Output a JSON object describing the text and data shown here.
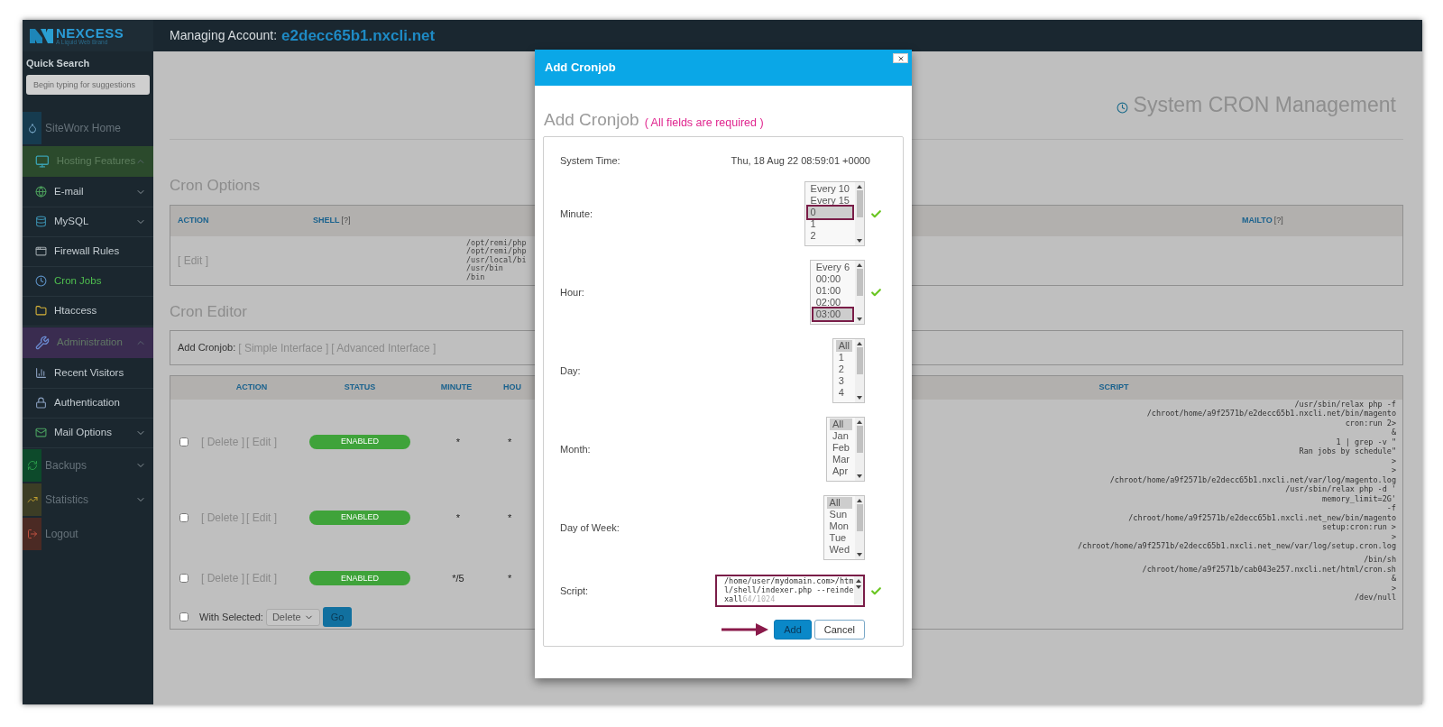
{
  "header": {
    "logo_name": "NEXCESS",
    "logo_tagline": "A Liquid Web Brand",
    "account_label": "Managing Account:",
    "account_name": "e2decc65b1.nxcli.net"
  },
  "sidebar": {
    "search_label": "Quick Search",
    "search_placeholder": "Begin typing for suggestions",
    "items": [
      {
        "label": "SiteWorx Home",
        "kind": "tile",
        "color": "#163b4f",
        "selected": false
      },
      {
        "label": "Hosting Features",
        "kind": "band",
        "color": "#2b4a2c",
        "selected": false,
        "expanded": true
      },
      {
        "label": "E-mail",
        "kind": "item",
        "selected": false,
        "expanded": false
      },
      {
        "label": "MySQL",
        "kind": "item",
        "selected": false,
        "expanded": false
      },
      {
        "label": "Firewall Rules",
        "kind": "item",
        "selected": false
      },
      {
        "label": "Cron Jobs",
        "kind": "item",
        "selected": true
      },
      {
        "label": "Htaccess",
        "kind": "item",
        "selected": false
      },
      {
        "label": "Administration",
        "kind": "band",
        "color": "#3a2c50",
        "selected": false,
        "expanded": true
      },
      {
        "label": "Recent Visitors",
        "kind": "item",
        "selected": false
      },
      {
        "label": "Authentication",
        "kind": "item",
        "selected": false
      },
      {
        "label": "Mail Options",
        "kind": "item",
        "selected": false,
        "expanded": false
      },
      {
        "label": "Backups",
        "kind": "tile",
        "color": "#0d4a2b",
        "selected": false,
        "expanded": false
      },
      {
        "label": "Statistics",
        "kind": "tile",
        "color": "#3c3d25",
        "selected": false,
        "expanded": false
      },
      {
        "label": "Logout",
        "kind": "tile",
        "color": "#4b2a24",
        "selected": false
      }
    ]
  },
  "page": {
    "title": "System CRON Management",
    "cron_options": {
      "heading": "Cron Options",
      "columns": [
        {
          "label": "ACTION"
        },
        {
          "label": "SHELL",
          "help": "[?]"
        },
        {
          "label": "MAILTO",
          "help": "[?]"
        }
      ],
      "row": {
        "action": "[ Edit ]",
        "shell": [
          "/opt/remi/php",
          "/opt/remi/php",
          "/usr/local/bi",
          "/usr/bin",
          "/bin"
        ]
      }
    },
    "cron_editor": {
      "heading": "Cron Editor",
      "add_label": "Add Cronjob:",
      "links": [
        "[ Simple Interface ]",
        "[ Advanced Interface ]"
      ],
      "columns": [
        "ACTION",
        "STATUS",
        "MINUTE",
        "HOU",
        "SCRIPT"
      ],
      "rows": [
        {
          "checked": false,
          "actions": [
            "[ Delete ]",
            "[ Edit ]"
          ],
          "status": "ENABLED",
          "enabled": true,
          "minute": "*",
          "hour": "*",
          "script": "/usr/sbin/relax php -f\n/chroot/home/a9f2571b/e2decc65b1.nxcli.net/bin/magento\ncron:run 2>\n&\n1 | grep -v \"\nRan jobs by schedule\"\n>\n>\n/chroot/home/a9f2571b/e2decc65b1.nxcli.net/var/log/magento.log"
        },
        {
          "checked": false,
          "actions": [
            "[ Delete ]",
            "[ Edit ]"
          ],
          "status": "ENABLED",
          "enabled": true,
          "minute": "*",
          "hour": "*",
          "script": "/usr/sbin/relax php -d '\nmemory_limit=2G'\n-f\n/chroot/home/a9f2571b/e2decc65b1.nxcli.net_new/bin/magento\nsetup:cron:run >\n>\n/chroot/home/a9f2571b/e2decc65b1.nxcli.net_new/var/log/setup.cron.log"
        },
        {
          "checked": false,
          "actions": [
            "[ Delete ]",
            "[ Edit ]"
          ],
          "status": "ENABLED",
          "enabled": true,
          "minute": "*/5",
          "hour": "*",
          "script": "/bin/sh\n/chroot/home/a9f2571b/cab043e257.nxcli.net/html/cron.sh\n&\n>\n/dev/null"
        }
      ],
      "footer": {
        "checked": false,
        "label": "With Selected:",
        "select": "Delete",
        "button": "Go"
      }
    }
  },
  "modal": {
    "title": "Add Cronjob",
    "heading": "Add Cronjob",
    "note": "( All fields are required )",
    "system_time_label": "System Time:",
    "system_time": "Thu, 18 Aug 22 08:59:01 +0000",
    "fields": [
      {
        "kind": "list",
        "label": "Minute:",
        "valid": true,
        "options": [
          {
            "label": "Every 10",
            "selected": false,
            "marked": false
          },
          {
            "label": "Every 15",
            "selected": false,
            "marked": false
          },
          {
            "label": "0",
            "selected": true,
            "marked": true
          },
          {
            "label": "1",
            "selected": false,
            "marked": false
          },
          {
            "label": "2",
            "selected": false,
            "marked": false
          }
        ]
      },
      {
        "kind": "list",
        "label": "Hour:",
        "valid": true,
        "options": [
          {
            "label": "Every 6",
            "selected": false,
            "marked": false
          },
          {
            "label": "00:00",
            "selected": false,
            "marked": false
          },
          {
            "label": "01:00",
            "selected": false,
            "marked": false
          },
          {
            "label": "02:00",
            "selected": false,
            "marked": false
          },
          {
            "label": "03:00",
            "selected": true,
            "marked": true
          }
        ]
      },
      {
        "kind": "list",
        "label": "Day:",
        "valid": false,
        "options": [
          {
            "label": "All",
            "selected": true,
            "marked": false
          },
          {
            "label": "1",
            "selected": false,
            "marked": false
          },
          {
            "label": "2",
            "selected": false,
            "marked": false
          },
          {
            "label": "3",
            "selected": false,
            "marked": false
          },
          {
            "label": "4",
            "selected": false,
            "marked": false
          }
        ]
      },
      {
        "kind": "list",
        "label": "Month:",
        "valid": false,
        "options": [
          {
            "label": "All",
            "selected": true,
            "marked": false
          },
          {
            "label": "Jan",
            "selected": false,
            "marked": false
          },
          {
            "label": "Feb",
            "selected": false,
            "marked": false
          },
          {
            "label": "Mar",
            "selected": false,
            "marked": false
          },
          {
            "label": "Apr",
            "selected": false,
            "marked": false
          }
        ]
      },
      {
        "kind": "list",
        "label": "Day of Week:",
        "valid": false,
        "options": [
          {
            "label": "All",
            "selected": true,
            "marked": false
          },
          {
            "label": "Sun",
            "selected": false,
            "marked": false
          },
          {
            "label": "Mon",
            "selected": false,
            "marked": false
          },
          {
            "label": "Tue",
            "selected": false,
            "marked": false
          },
          {
            "label": "Wed",
            "selected": false,
            "marked": false
          }
        ]
      },
      {
        "kind": "text",
        "label": "Script:",
        "valid": true,
        "marked": true,
        "value": "/home/user/mydomain.com>/html/shell/indexer.php --reindexall",
        "counter": "64/1024"
      }
    ],
    "buttons": [
      {
        "label": "Add",
        "kind": "primary"
      },
      {
        "label": "Cancel",
        "kind": "secondary"
      }
    ]
  }
}
